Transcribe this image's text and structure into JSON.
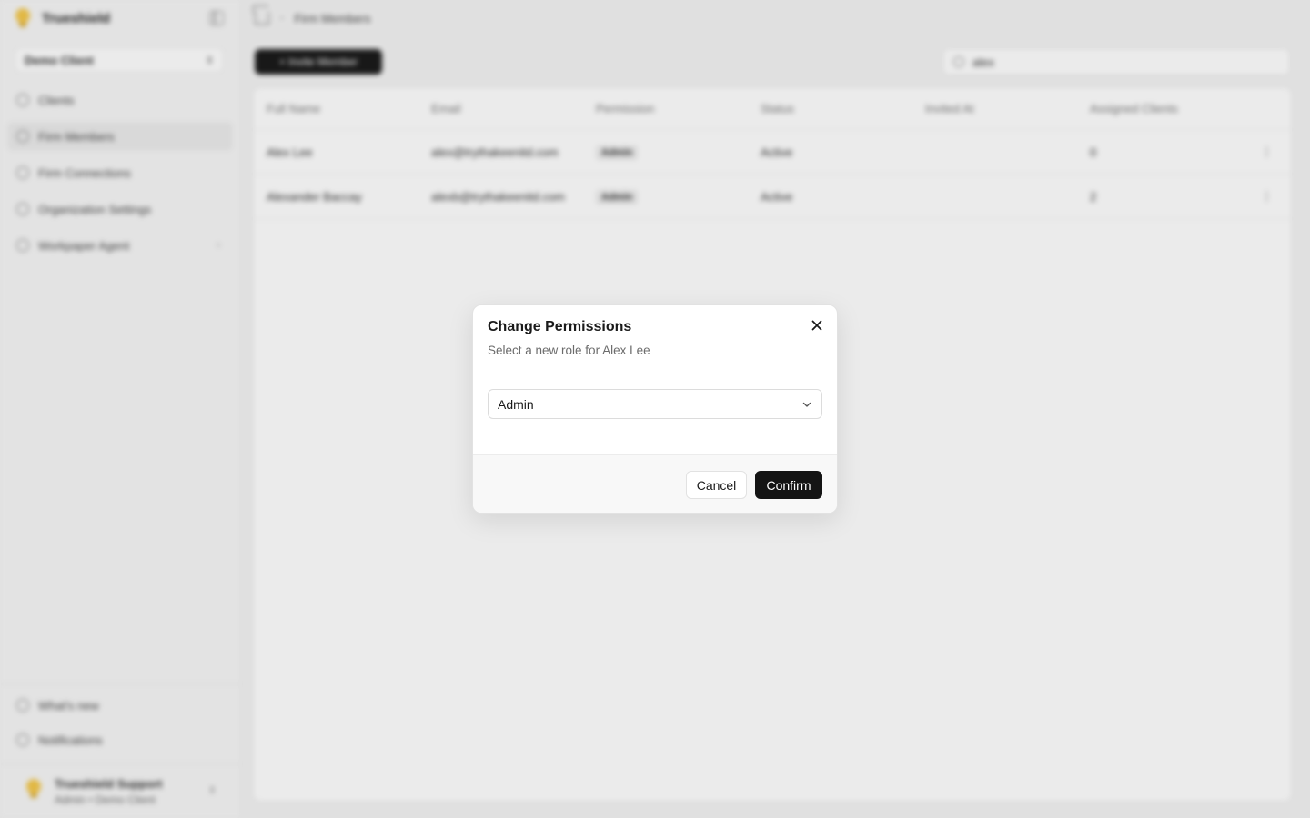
{
  "app": {
    "brand": "Trueshield",
    "client_selector": "Demo Client"
  },
  "sidebar": {
    "items": [
      {
        "label": "Clients",
        "icon": "globe-icon"
      },
      {
        "label": "Firm Members",
        "icon": "user-icon",
        "active": true
      },
      {
        "label": "Firm Connections",
        "icon": "plug-icon"
      },
      {
        "label": "Organization Settings",
        "icon": "gear-icon"
      },
      {
        "label": "Workpaper Agent",
        "icon": "wand-icon"
      }
    ],
    "bottom": [
      {
        "label": "What's new",
        "icon": "gift-icon"
      },
      {
        "label": "Notifications",
        "icon": "bell-icon"
      }
    ],
    "user": {
      "name": "Trueshield Support",
      "role": "Admin • Demo Client"
    }
  },
  "header": {
    "breadcrumb": "Firm Members"
  },
  "toolbar": {
    "invite_label": "+ Invite Member",
    "search_value": "alex"
  },
  "table": {
    "columns": [
      "Full Name",
      "Email",
      "Permission",
      "Status",
      "Invited At",
      "Assigned Clients"
    ],
    "rows": [
      {
        "name": "Alex Lee",
        "email": "alex@trythakeenitd.com",
        "permission": "Admin",
        "status": "Active",
        "invited": "",
        "assigned": "0"
      },
      {
        "name": "Alexander Baccay",
        "email": "alexb@trythakeenitd.com",
        "permission": "Admin",
        "status": "Active",
        "invited": "",
        "assigned": "2"
      }
    ]
  },
  "dialog": {
    "title": "Change Permissions",
    "description": "Select a new role for Alex Lee",
    "selected_role": "Admin",
    "cancel_label": "Cancel",
    "confirm_label": "Confirm"
  },
  "colors": {
    "primary_button": "#141414",
    "accent_bulb": "#f5c84b"
  }
}
